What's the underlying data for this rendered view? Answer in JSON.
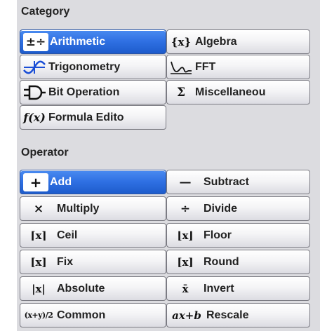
{
  "category": {
    "title": "Category",
    "items": [
      {
        "label": "Arithmetic",
        "icon": "plus-minus-times-divide-icon",
        "glyph": "±÷",
        "selected": true
      },
      {
        "label": "Algebra",
        "icon": "algebra-x-icon",
        "glyph": "{x}"
      },
      {
        "label": "Trigonometry",
        "icon": "sine-wave-icon",
        "glyph": "∿"
      },
      {
        "label": "FFT",
        "icon": "fft-spectrum-icon",
        "glyph": ""
      },
      {
        "label": "Bit Operation",
        "icon": "logic-gate-icon",
        "glyph": "⊃"
      },
      {
        "label": "Miscellaneou",
        "icon": "sigma-icon",
        "glyph": "Σ"
      },
      {
        "label": "Formula Edito",
        "icon": "function-icon",
        "glyph": "f(x)"
      }
    ]
  },
  "operator": {
    "title": "Operator",
    "items": [
      {
        "label": "Add",
        "icon": "plus-icon",
        "glyph": "+",
        "selected": true
      },
      {
        "label": "Subtract",
        "icon": "minus-icon",
        "glyph": "—"
      },
      {
        "label": "Multiply",
        "icon": "multiply-icon",
        "glyph": "×"
      },
      {
        "label": "Divide",
        "icon": "divide-icon",
        "glyph": "÷"
      },
      {
        "label": "Ceil",
        "icon": "ceil-icon",
        "glyph": "⌈x⌉"
      },
      {
        "label": "Floor",
        "icon": "floor-icon",
        "glyph": "⌊x⌋"
      },
      {
        "label": "Fix",
        "icon": "fix-icon",
        "glyph": "[x]"
      },
      {
        "label": "Round",
        "icon": "round-icon",
        "glyph": "[x]"
      },
      {
        "label": "Absolute",
        "icon": "absolute-value-icon",
        "glyph": "|x|"
      },
      {
        "label": "Invert",
        "icon": "invert-icon",
        "glyph": "x̄"
      },
      {
        "label": "Common",
        "icon": "common-fraction-icon",
        "glyph": "(x+y)/2"
      },
      {
        "label": "Rescale",
        "icon": "rescale-icon",
        "glyph": "ax+b"
      }
    ]
  },
  "colors": {
    "panel_bg": "#dcdce0",
    "selected_bg": "#2e6fe2",
    "button_border": "#7c7c84"
  }
}
